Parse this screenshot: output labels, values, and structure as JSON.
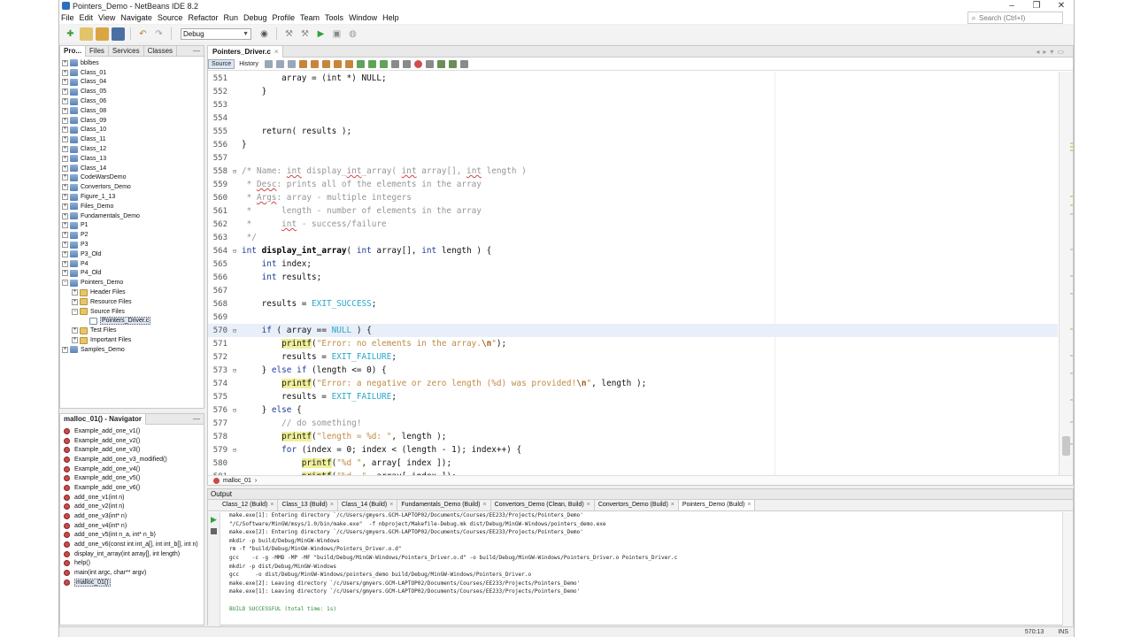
{
  "window": {
    "title": "Pointers_Demo - NetBeans IDE 8.2",
    "minimize": "–",
    "maximize": "❐",
    "close": "✕"
  },
  "menu": [
    "File",
    "Edit",
    "View",
    "Navigate",
    "Source",
    "Refactor",
    "Run",
    "Debug",
    "Profile",
    "Team",
    "Tools",
    "Window",
    "Help"
  ],
  "search": {
    "placeholder": "Search (Ctrl+I)"
  },
  "toolbar": {
    "config": "Debug"
  },
  "projects_panel": {
    "tabs": [
      "Pro...",
      "Files",
      "Services",
      "Classes"
    ],
    "items": [
      {
        "label": "bblbes",
        "level": 0,
        "kind": "proj"
      },
      {
        "label": "Class_01",
        "level": 0,
        "kind": "proj"
      },
      {
        "label": "Class_04",
        "level": 0,
        "kind": "proj"
      },
      {
        "label": "Class_05",
        "level": 0,
        "kind": "proj"
      },
      {
        "label": "Class_06",
        "level": 0,
        "kind": "proj"
      },
      {
        "label": "Class_08",
        "level": 0,
        "kind": "proj"
      },
      {
        "label": "Class_09",
        "level": 0,
        "kind": "proj"
      },
      {
        "label": "Class_10",
        "level": 0,
        "kind": "proj"
      },
      {
        "label": "Class_11",
        "level": 0,
        "kind": "proj"
      },
      {
        "label": "Class_12",
        "level": 0,
        "kind": "proj"
      },
      {
        "label": "Class_13",
        "level": 0,
        "kind": "proj"
      },
      {
        "label": "Class_14",
        "level": 0,
        "kind": "proj"
      },
      {
        "label": "CodeWarsDemo",
        "level": 0,
        "kind": "proj"
      },
      {
        "label": "Convertors_Demo",
        "level": 0,
        "kind": "proj"
      },
      {
        "label": "Figure_1_13",
        "level": 0,
        "kind": "proj"
      },
      {
        "label": "Files_Demo",
        "level": 0,
        "kind": "proj"
      },
      {
        "label": "Fundamentals_Demo",
        "level": 0,
        "kind": "proj"
      },
      {
        "label": "P1",
        "level": 0,
        "kind": "proj"
      },
      {
        "label": "P2",
        "level": 0,
        "kind": "proj"
      },
      {
        "label": "P3",
        "level": 0,
        "kind": "proj"
      },
      {
        "label": "P3_Old",
        "level": 0,
        "kind": "proj"
      },
      {
        "label": "P4",
        "level": 0,
        "kind": "proj"
      },
      {
        "label": "P4_Old",
        "level": 0,
        "kind": "proj"
      },
      {
        "label": "Pointers_Demo",
        "level": 0,
        "kind": "proj",
        "open": true
      },
      {
        "label": "Header Files",
        "level": 1,
        "kind": "folder"
      },
      {
        "label": "Resource Files",
        "level": 1,
        "kind": "folder"
      },
      {
        "label": "Source Files",
        "level": 1,
        "kind": "folder",
        "open": true
      },
      {
        "label": "Pointers_Driver.c",
        "level": 2,
        "kind": "file",
        "selected": true
      },
      {
        "label": "Test Files",
        "level": 1,
        "kind": "folder"
      },
      {
        "label": "Important Files",
        "level": 1,
        "kind": "folder"
      },
      {
        "label": "Samples_Demo",
        "level": 0,
        "kind": "proj"
      }
    ]
  },
  "navigator": {
    "title": "malloc_01() - Navigator",
    "items": [
      "Example_add_one_v1()",
      "Example_add_one_v2()",
      "Example_add_one_v3()",
      "Example_add_one_v3_modified()",
      "Example_add_one_v4()",
      "Example_add_one_v5()",
      "Example_add_one_v6()",
      "add_one_v1(int n)",
      "add_one_v2(int n)",
      "add_one_v3(int* n)",
      "add_one_v4(int* n)",
      "add_one_v5(int n_a, int* n_b)",
      "add_one_v6(const int int_a[], int int_b[], int n)",
      "display_int_array(int array[], int length)",
      "help()",
      "main(int argc, char** argv)",
      "malloc_01()"
    ]
  },
  "editor": {
    "tab": "Pointers_Driver.c",
    "modes": [
      "Source",
      "History"
    ],
    "breadcrumb": "malloc_01",
    "current_line": 570
  },
  "output": {
    "title": "Output",
    "tabs": [
      "Class_12 (Build)",
      "Class_13 (Build)",
      "Class_14 (Build)",
      "Fundamentals_Demo (Build)",
      "Convertors_Demo (Clean, Build)",
      "Convertors_Demo (Build)",
      "Pointers_Demo (Build)"
    ],
    "lines": [
      "make.exe[1]: Entering directory `/c/Users/gmyers.GCM-LAPTOP02/Documents/Courses/EE233/Projects/Pointers_Demo'",
      "\"/C/Software/MinGW/msys/1.0/bin/make.exe\"  -f nbproject/Makefile-Debug.mk dist/Debug/MinGW-Windows/pointers_demo.exe",
      "make.exe[2]: Entering directory `/c/Users/gmyers.GCM-LAPTOP02/Documents/Courses/EE233/Projects/Pointers_Demo'",
      "mkdir -p build/Debug/MinGW-Windows",
      "rm -f \"build/Debug/MinGW-Windows/Pointers_Driver.o.d\"",
      "gcc    -c -g -MMD -MP -MF \"build/Debug/MinGW-Windows/Pointers_Driver.o.d\" -o build/Debug/MinGW-Windows/Pointers_Driver.o Pointers_Driver.c",
      "mkdir -p dist/Debug/MinGW-Windows",
      "gcc     -o dist/Debug/MinGW-Windows/pointers_demo build/Debug/MinGW-Windows/Pointers_Driver.o",
      "make.exe[2]: Leaving directory `/c/Users/gmyers.GCM-LAPTOP02/Documents/Courses/EE233/Projects/Pointers_Demo'",
      "make.exe[1]: Leaving directory `/c/Users/gmyers.GCM-LAPTOP02/Documents/Courses/EE233/Projects/Pointers_Demo'",
      "",
      "BUILD SUCCESSFUL (total time: 1s)"
    ]
  },
  "statusbar": {
    "position": "570:13",
    "mode": "INS"
  }
}
